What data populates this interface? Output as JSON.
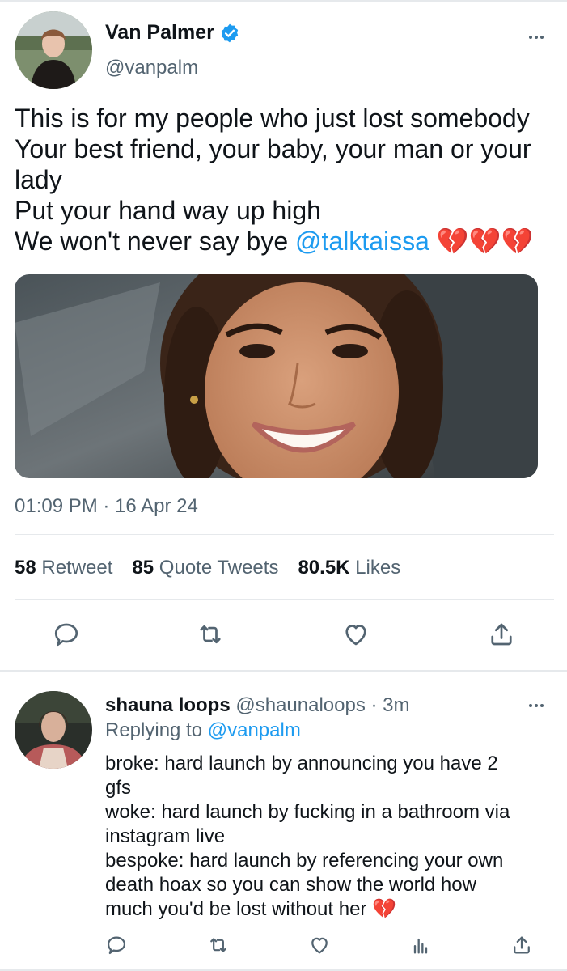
{
  "tweet": {
    "display_name": "Van Palmer",
    "handle": "@vanpalm",
    "verified": true,
    "text_lines": [
      "This is for my people who just lost somebody",
      "Your best friend, your baby, your man or your",
      "lady",
      "Put your hand way up high"
    ],
    "last_line_prefix": "We won't never say bye ",
    "mention": "@talktaissa",
    "emoji": "💔💔💔",
    "timestamp": "01:09 PM · 16 Apr 24",
    "stats": {
      "retweets_count": "58",
      "retweets_label": "Retweet",
      "quotes_count": "85",
      "quotes_label": "Quote Tweets",
      "likes_count": "80.5K",
      "likes_label": "Likes"
    }
  },
  "reply": {
    "display_name": "shauna loops",
    "handle_time": "@shaunaloops · 3m",
    "replying_to_label": "Replying to",
    "replying_to_handle": "@vanpalm",
    "text": "broke: hard launch by announcing you have 2\ngfs\nwoke: hard launch by fucking in a bathroom via\ninstagram live\nbespoke: hard launch by referencing your own\ndeath hoax so you can show the world how\nmuch you'd be lost without her",
    "emoji": "💔"
  },
  "icons": [
    "reply-icon",
    "retweet-icon",
    "like-icon",
    "share-icon",
    "analytics-icon",
    "verified-icon",
    "more-icon"
  ],
  "colors": {
    "accent": "#1d9bf0",
    "secondary_text": "#536471",
    "divider": "#e6e9ec"
  }
}
